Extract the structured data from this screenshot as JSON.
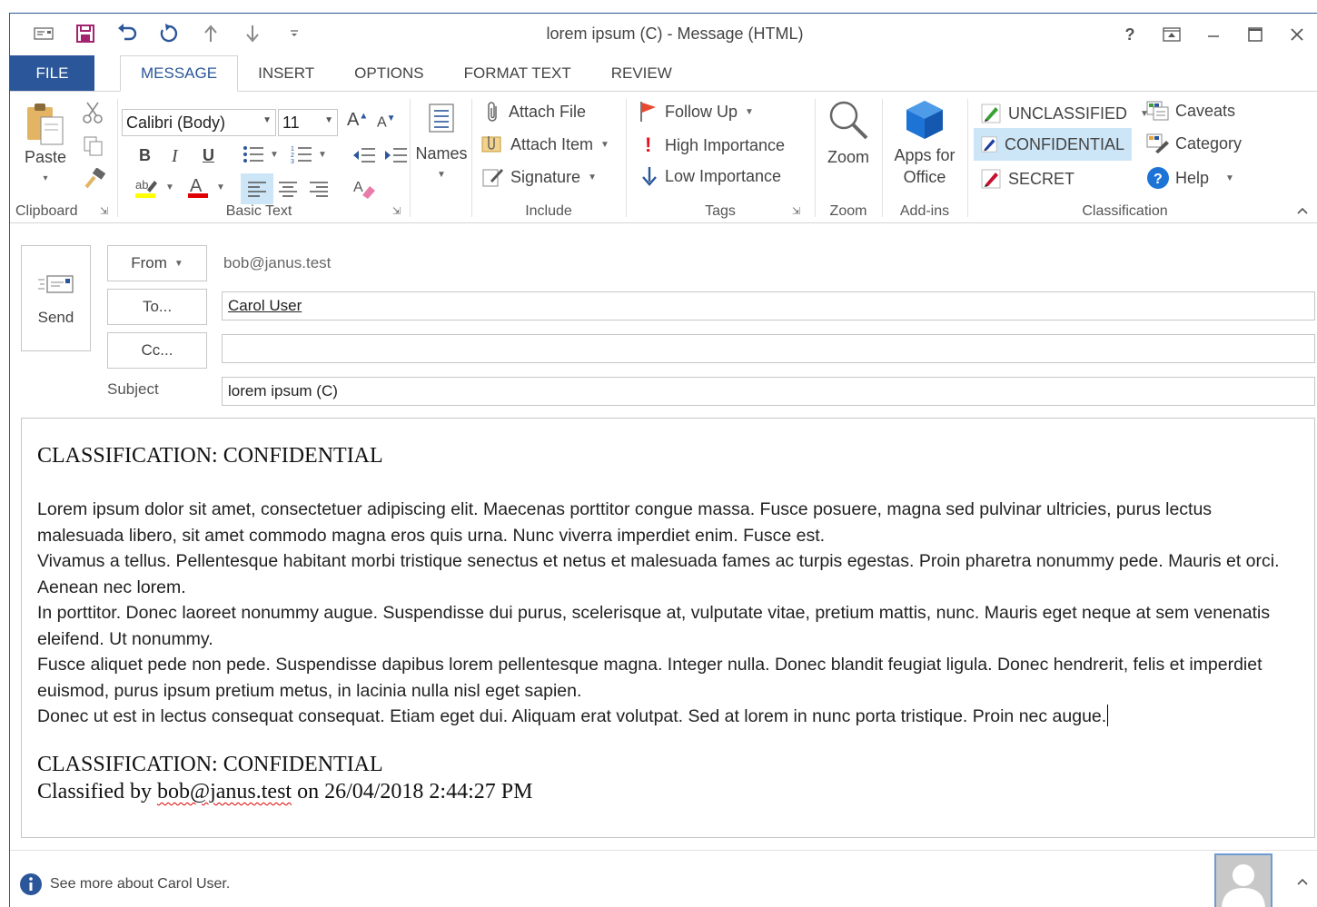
{
  "window": {
    "title": "lorem ipsum (C) - Message (HTML)",
    "controls": {
      "help": "?"
    }
  },
  "tabs": [
    "FILE",
    "MESSAGE",
    "INSERT",
    "OPTIONS",
    "FORMAT TEXT",
    "REVIEW"
  ],
  "ribbon": {
    "clipboard": {
      "label": "Clipboard",
      "paste": "Paste"
    },
    "basic_text": {
      "label": "Basic Text",
      "font": "Calibri (Body)",
      "size": "11",
      "bold": "B",
      "italic": "I",
      "underline": "U"
    },
    "names": {
      "label": "Names"
    },
    "include": {
      "label": "Include",
      "attach_file": "Attach File",
      "attach_item": "Attach Item",
      "signature": "Signature"
    },
    "tags": {
      "label": "Tags",
      "follow_up": "Follow Up",
      "high": "High Importance",
      "low": "Low Importance"
    },
    "zoom": {
      "label": "Zoom",
      "button": "Zoom"
    },
    "addins": {
      "label": "Add-ins",
      "apps_line1": "Apps for",
      "apps_line2": "Office"
    },
    "classification": {
      "label": "Classification",
      "unclassified": "UNCLASSIFIED",
      "confidential": "CONFIDENTIAL",
      "secret": "SECRET",
      "caveats": "Caveats",
      "category": "Category",
      "help": "Help"
    }
  },
  "compose": {
    "send": "Send",
    "from_label": "From",
    "from_value": "bob@janus.test",
    "to_label": "To...",
    "to_value": "Carol User",
    "cc_label": "Cc...",
    "cc_value": "",
    "subject_label": "Subject",
    "subject_value": "lorem ipsum (C)"
  },
  "body": {
    "heading": "CLASSIFICATION: CONFIDENTIAL",
    "paragraphs": [
      "Lorem ipsum dolor sit amet, consectetuer adipiscing elit. Maecenas porttitor congue massa. Fusce posuere, magna sed pulvinar ultricies, purus lectus malesuada libero, sit amet commodo magna eros quis urna. Nunc viverra imperdiet enim. Fusce est.",
      "Vivamus a tellus. Pellentesque habitant morbi tristique senectus et netus et malesuada fames ac turpis egestas. Proin pharetra nonummy pede. Mauris et orci. Aenean nec lorem.",
      "In porttitor. Donec laoreet nonummy augue. Suspendisse dui purus, scelerisque at, vulputate vitae, pretium mattis, nunc. Mauris eget neque at sem venenatis eleifend. Ut nonummy.",
      "Fusce aliquet pede non pede. Suspendisse dapibus lorem pellentesque magna. Integer nulla. Donec blandit feugiat ligula. Donec hendrerit, felis et imperdiet euismod, purus ipsum pretium metus, in lacinia nulla nisl eget sapien.",
      "Donec ut est in lectus consequat consequat. Etiam eget dui. Aliquam erat volutpat. Sed at lorem in nunc porta tristique. Proin nec augue."
    ],
    "footer_heading": "CLASSIFICATION: CONFIDENTIAL",
    "footer_pre": "Classified by ",
    "footer_email": "bob@janus.test",
    "footer_post": " on 26/04/2018 2:44:27 PM"
  },
  "people_pane": {
    "text": "See more about Carol User."
  },
  "colors": {
    "accent": "#2b579a",
    "highlight": "#cde6f7",
    "flag": "#e8492e",
    "high_importance": "#e81123",
    "low_importance": "#2b579a"
  }
}
